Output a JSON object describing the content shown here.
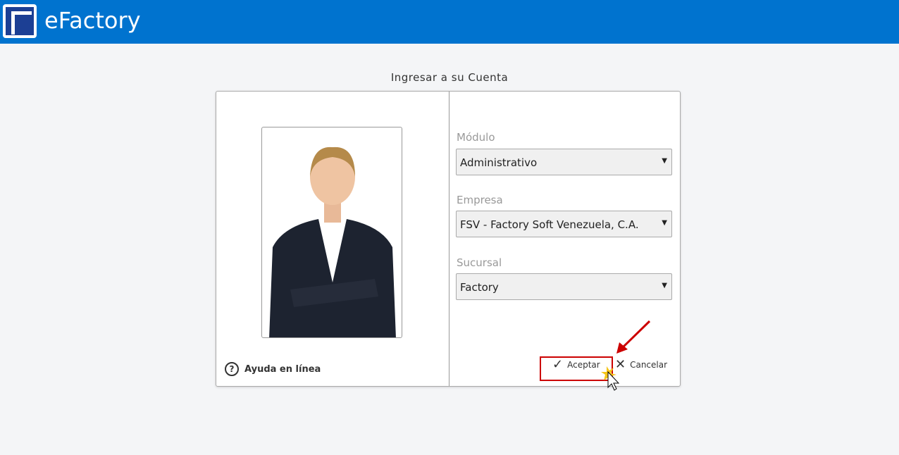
{
  "header": {
    "app_title": "eFactory"
  },
  "login": {
    "title": "Ingresar a su Cuenta",
    "help_label": "Ayuda en línea",
    "modulo_label": "Módulo",
    "modulo_value": "Administrativo",
    "empresa_label": "Empresa",
    "empresa_value": "FSV - Factory Soft Venezuela, C.A.",
    "sucursal_label": "Sucursal",
    "sucursal_value": "Factory",
    "accept_label": "Aceptar",
    "cancel_label": "Cancelar"
  }
}
